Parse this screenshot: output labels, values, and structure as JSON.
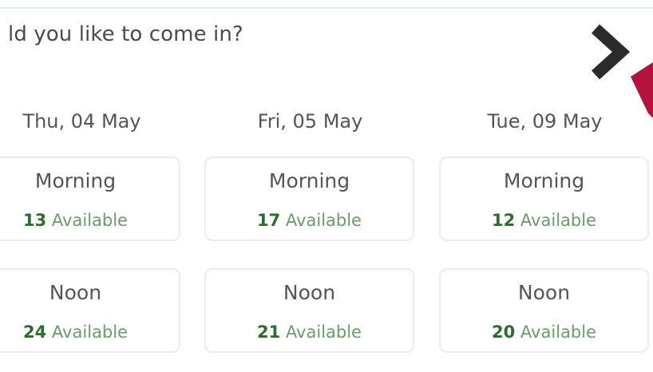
{
  "question": "ld you like to come in?",
  "icons": {
    "next": "chevron-right-icon",
    "accent": "ribbon-corner-shape"
  },
  "colors": {
    "accent": "#b5123e",
    "count": "#2e6b2e",
    "available_text": "#6d9a6d",
    "arrow": "#2b2b2b"
  },
  "days": [
    {
      "label": "Thu, 04 May",
      "slots": [
        {
          "title": "Morning",
          "count": "13",
          "available_label": "Available"
        },
        {
          "title": "Noon",
          "count": "24",
          "available_label": "Available"
        }
      ]
    },
    {
      "label": "Fri, 05 May",
      "slots": [
        {
          "title": "Morning",
          "count": "17",
          "available_label": "Available"
        },
        {
          "title": "Noon",
          "count": "21",
          "available_label": "Available"
        }
      ]
    },
    {
      "label": "Tue, 09 May",
      "slots": [
        {
          "title": "Morning",
          "count": "12",
          "available_label": "Available"
        },
        {
          "title": "Noon",
          "count": "20",
          "available_label": "Available"
        }
      ]
    }
  ]
}
